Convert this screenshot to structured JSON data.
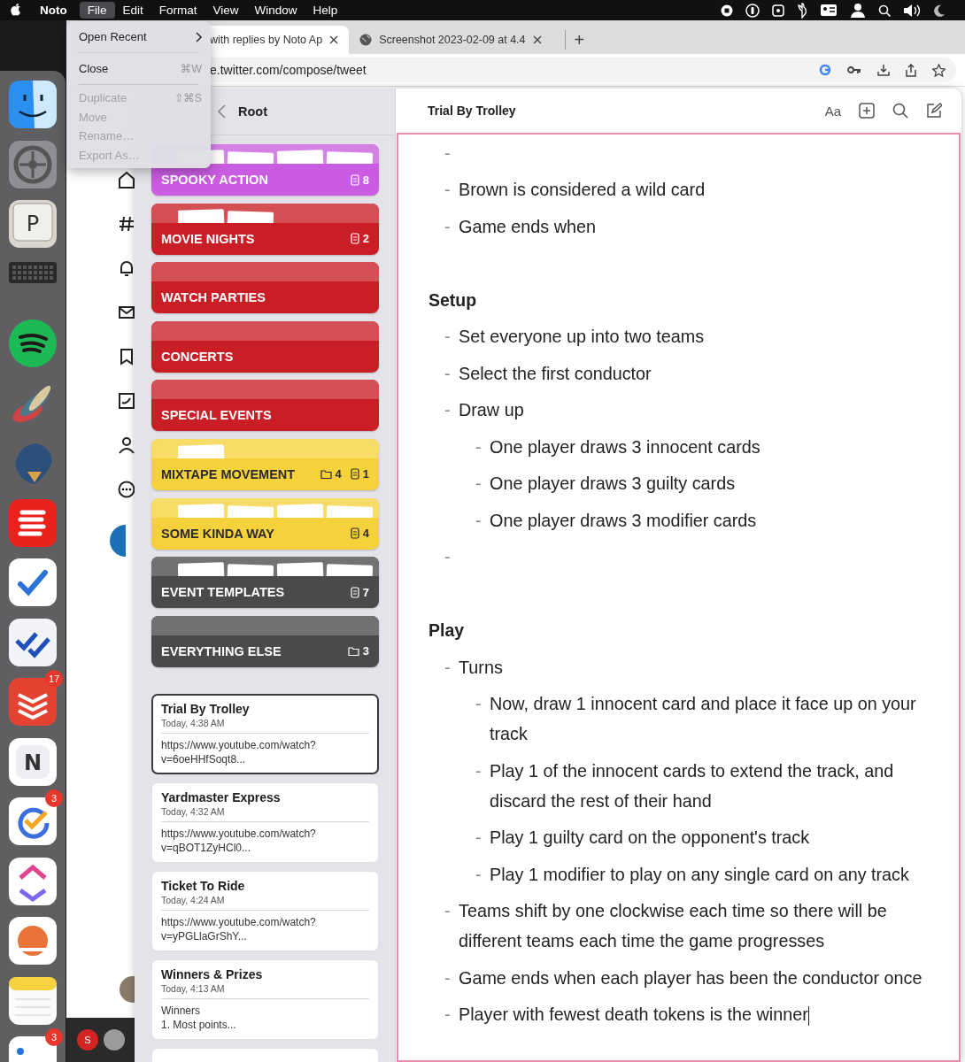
{
  "menu_bar": {
    "app": "Noto",
    "items": [
      {
        "label": "File",
        "selected": true
      },
      {
        "label": "Edit",
        "selected": false
      },
      {
        "label": "Format",
        "selected": false
      },
      {
        "label": "View",
        "selected": false
      },
      {
        "label": "Window",
        "selected": false
      },
      {
        "label": "Help",
        "selected": false
      }
    ]
  },
  "file_menu": [
    {
      "kind": "submenu",
      "label": "Open Recent",
      "disabled": false
    },
    {
      "kind": "separator"
    },
    {
      "kind": "item",
      "label": "Close",
      "shortcut": "⌘W",
      "disabled": false
    },
    {
      "kind": "separator"
    },
    {
      "kind": "item",
      "label": "Duplicate",
      "shortcut": "⇧⌘S",
      "disabled": true
    },
    {
      "kind": "item",
      "label": "Move",
      "disabled": true
    },
    {
      "kind": "item",
      "label": "Rename…",
      "disabled": true
    },
    {
      "kind": "item",
      "label": "Export As…",
      "disabled": true
    }
  ],
  "dock": [
    {
      "kind": "finder"
    },
    {
      "kind": "gear"
    },
    {
      "kind": "key",
      "letter": "P"
    },
    {
      "kind": "keyboard"
    },
    {
      "kind": "waves"
    },
    {
      "kind": "feathers"
    },
    {
      "kind": "bird"
    },
    {
      "kind": "stripes"
    },
    {
      "kind": "check"
    },
    {
      "kind": "double-check"
    },
    {
      "kind": "layers",
      "badge": "17"
    },
    {
      "kind": "letter",
      "letter": "N"
    },
    {
      "kind": "circle-check",
      "badge": "3"
    },
    {
      "kind": "chevrons"
    },
    {
      "kind": "sun"
    },
    {
      "kind": "notepad"
    },
    {
      "kind": "dot",
      "badge": "3"
    }
  ],
  "browser": {
    "tabs": [
      {
        "title": "with replies by Noto Ap",
        "selected": true
      },
      {
        "title": "Screenshot 2023-02-09 at 4.4",
        "selected": false
      }
    ],
    "new_tab": "+",
    "url": "e.twitter.com/compose/tweet",
    "account_initial": "S"
  },
  "noto": {
    "sidebar": {
      "title": "Root",
      "notebooks": [
        {
          "title": "SPOOKY ACTION",
          "color": "#c95ce0",
          "notes": "8"
        },
        {
          "title": "MOVIE NIGHTS",
          "color": "#c91e25",
          "notes": "2"
        },
        {
          "title": "WATCH PARTIES",
          "color": "#c91e25"
        },
        {
          "title": "CONCERTS",
          "color": "#c91e25"
        },
        {
          "title": "SPECIAL EVENTS",
          "color": "#c91e25"
        },
        {
          "title": "MIXTAPE MOVEMENT",
          "color": "#f5d23c",
          "folders": "4",
          "notes": "1"
        },
        {
          "title": "SOME KINDA WAY",
          "color": "#f5d23c",
          "notes": "4"
        },
        {
          "title": "EVENT TEMPLATES",
          "color": "#4a4a4a",
          "notes": "7"
        },
        {
          "title": "EVERYTHING ELSE",
          "color": "#4a4a4a",
          "folders": "3"
        }
      ],
      "notes": [
        {
          "title": "Trial By Trolley",
          "date": "Today, 4:38 AM",
          "preview": [
            "https://www.youtube.com/watch?",
            "v=6oeHHfSoqt8..."
          ],
          "selected": true
        },
        {
          "title": "Yardmaster Express",
          "date": "Today, 4:32 AM",
          "preview": [
            "https://www.youtube.com/watch?",
            "v=qBOT1ZyHCl0..."
          ],
          "selected": false
        },
        {
          "title": "Ticket To Ride",
          "date": "Today, 4:24 AM",
          "preview": [
            "https://www.youtube.com/watch?",
            "v=yPGLlaGrShY..."
          ],
          "selected": false
        },
        {
          "title": "Winners & Prizes",
          "date": "Today, 4:13 AM",
          "preview": [
            "Winners",
            "1. Most points..."
          ],
          "selected": false
        }
      ],
      "more_below": true
    },
    "editor": {
      "title": "Trial By Trolley",
      "format_button": "Aa",
      "blocks": [
        {
          "kind": "bullet",
          "marker": "-"
        },
        {
          "kind": "bullet",
          "marker": "-",
          "text": "Brown is considered a wild card"
        },
        {
          "kind": "bullet",
          "marker": "-",
          "text": "Game ends when"
        },
        {
          "kind": "heading",
          "text": "Setup"
        },
        {
          "kind": "bullet",
          "marker": "-",
          "text": "Set everyone up into two teams"
        },
        {
          "kind": "bullet",
          "marker": "-",
          "text": "Select the first conductor"
        },
        {
          "kind": "bullet",
          "marker": "-",
          "text": "Draw up",
          "children": [
            {
              "kind": "bullet",
              "marker": "-",
              "text": "One player draws 3 innocent cards"
            },
            {
              "kind": "bullet",
              "marker": "-",
              "text": "One player draws 3 guilty cards"
            },
            {
              "kind": "bullet",
              "marker": "-",
              "text": "One player draws 3 modifier cards"
            }
          ]
        },
        {
          "kind": "bullet",
          "marker": "-"
        },
        {
          "kind": "heading",
          "text": "Play"
        },
        {
          "kind": "bullet",
          "marker": "-",
          "text": "Turns",
          "children": [
            {
              "kind": "bullet",
              "marker": "-",
              "text": "Now, draw 1 innocent card and place it face up on your track"
            },
            {
              "kind": "bullet",
              "marker": "-",
              "text": "Play 1 of the innocent cards to extend the track, and discard the rest of their hand"
            },
            {
              "kind": "bullet",
              "marker": "-",
              "text": "Play 1 guilty card on the opponent's track"
            },
            {
              "kind": "bullet",
              "marker": "-",
              "text": "Play 1 modifier to play on any single card on any track"
            }
          ]
        },
        {
          "kind": "bullet",
          "marker": "-",
          "text": "Teams shift by one clockwise each time so there will be different teams each time the game progresses"
        },
        {
          "kind": "bullet",
          "marker": "-",
          "text": "Game ends when each player has been the conductor once"
        },
        {
          "kind": "bullet",
          "marker": "-",
          "text": "Player with fewest death tokens is the winner",
          "cursor": true
        }
      ]
    }
  }
}
